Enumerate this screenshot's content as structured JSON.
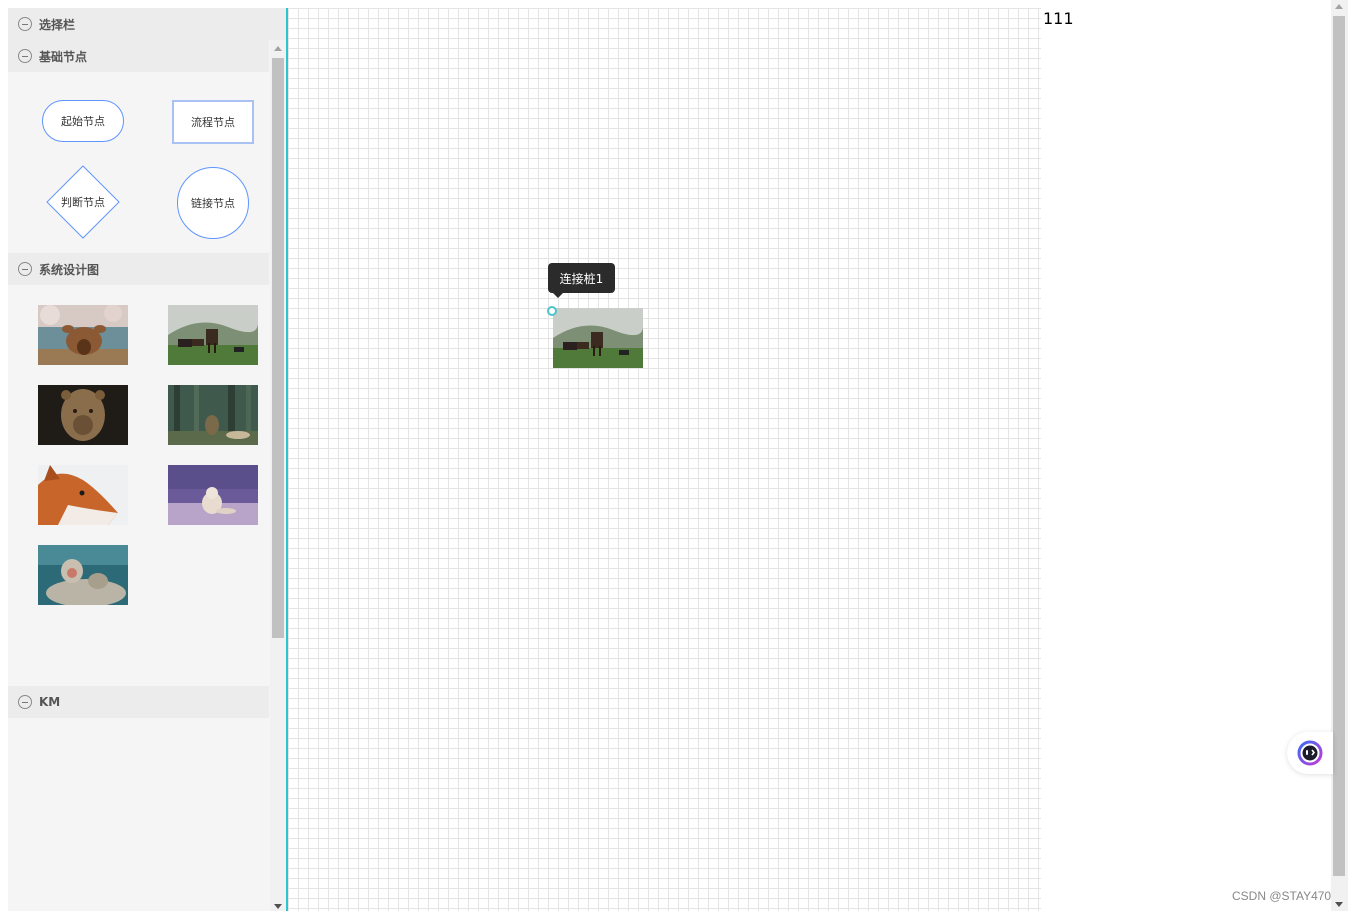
{
  "sidebar": {
    "title": "选择栏",
    "groups": [
      {
        "label": "基础节点",
        "nodes": [
          {
            "label": "起始节点",
            "shape": "ellipse"
          },
          {
            "label": "流程节点",
            "shape": "rect"
          },
          {
            "label": "判断节点",
            "shape": "diamond"
          },
          {
            "label": "链接节点",
            "shape": "circle"
          }
        ]
      },
      {
        "label": "系统设计图",
        "images": [
          "deer-icon",
          "horses-icon",
          "lioness-icon",
          "forest-animals-icon",
          "fox-icon",
          "arctic-fox-icon",
          "monkey-icon"
        ]
      },
      {
        "label": "KM"
      }
    ]
  },
  "canvas": {
    "tooltip": "连接桩1",
    "image": "horses-icon"
  },
  "counter": "111",
  "watermark": "CSDN @STAY470",
  "colors": {
    "accent": "#5f95ff",
    "canvas_border": "#2bc4d0",
    "port": "#4bc4cc"
  }
}
